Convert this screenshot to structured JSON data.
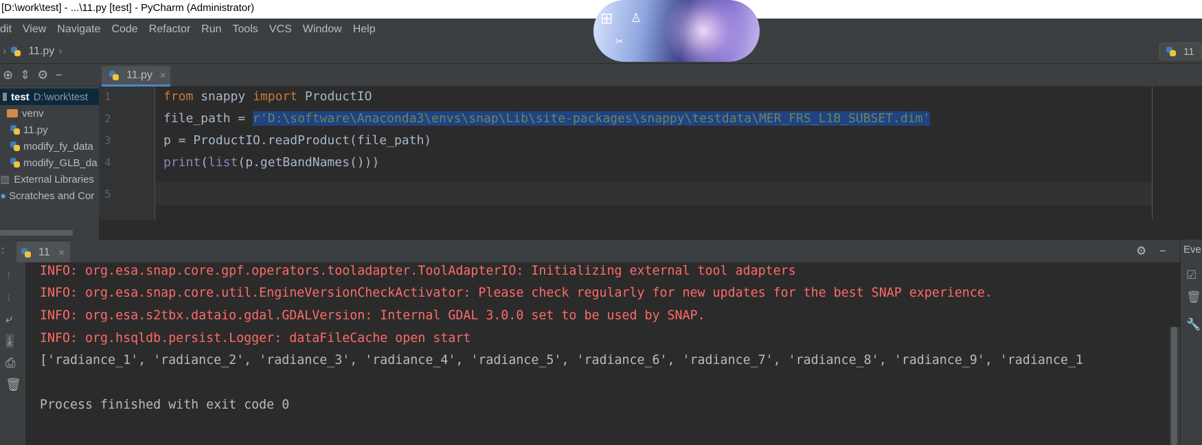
{
  "window": {
    "title": "[D:\\work\\test] - ...\\11.py [test] - PyCharm (Administrator)"
  },
  "menu": [
    "dit",
    "View",
    "Navigate",
    "Code",
    "Refactor",
    "Run",
    "Tools",
    "VCS",
    "Window",
    "Help"
  ],
  "navbar": {
    "file": "11.py",
    "run_config": "11"
  },
  "editor_tab": {
    "label": "11.py"
  },
  "project": {
    "root_name": "test",
    "root_path": "D:\\work\\test",
    "items": [
      "venv",
      "11.py",
      "modify_fy_data",
      "modify_GLB_da"
    ],
    "external_libraries": "External Libraries",
    "scratches": "Scratches and Cor"
  },
  "editor": {
    "line_numbers": [
      "1",
      "2",
      "3",
      "4",
      "5"
    ],
    "line1": {
      "kw1": "from",
      "mod": " snappy ",
      "kw2": "import",
      "name": " ProductIO"
    },
    "line2": {
      "prefix": "file_path = ",
      "string": "r'D:\\software\\Anaconda3\\envs\\snap\\Lib\\site-packages\\snappy\\testdata\\MER_FRS_L1B_SUBSET.dim'"
    },
    "line3": "p = ProductIO.readProduct(file_path)",
    "line4": {
      "fn": "print",
      "open": "(",
      "fn2": "list",
      "rest": "(p.getBandNames()))"
    }
  },
  "run_panel": {
    "tab_label": "11",
    "right_label": "Eve",
    "lines": [
      "INFO: org.esa.snap.core.gpf.operators.tooladapter.ToolAdapterIO: Initializing external tool adapters",
      "INFO: org.esa.snap.core.util.EngineVersionCheckActivator: Please check regularly for new updates for the best SNAP experience.",
      "INFO: org.esa.s2tbx.dataio.gdal.GDALVersion: Internal GDAL 3.0.0 set to be used by SNAP.",
      "INFO: org.hsqldb.persist.Logger: dataFileCache open start",
      "['radiance_1', 'radiance_2', 'radiance_3', 'radiance_4', 'radiance_5', 'radiance_6', 'radiance_7', 'radiance_8', 'radiance_9', 'radiance_1",
      "",
      "Process finished with exit code 0"
    ]
  },
  "colors": {
    "keyword": "#cc7832",
    "string": "#6a8759",
    "error_text": "#ff6b68",
    "selection": "#214283",
    "background": "#2b2b2b",
    "panel": "#3c3f41"
  }
}
